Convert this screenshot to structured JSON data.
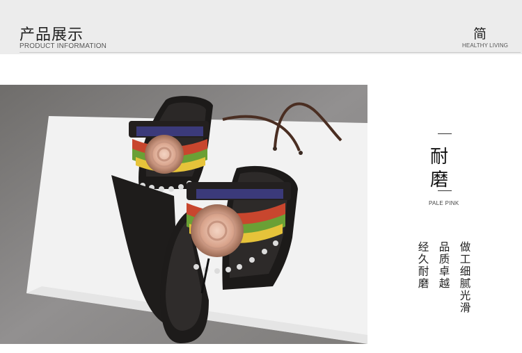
{
  "header": {
    "title": "产品展示",
    "subtitle": "PRODUCT INFORMATION",
    "brand_char": "简",
    "brand_en": "HEALTHY LIVING"
  },
  "product": {
    "feature_line1": "耐",
    "feature_line2": "磨",
    "color_name": "PALE PINK",
    "desc_col1": "做工细腻光滑",
    "desc_col2": "品质卓越",
    "desc_col3": "经久耐磨"
  },
  "colors": {
    "header_bg": "#ececec",
    "photo_bg": "#8a8886",
    "sole": "#1a1817",
    "bag": "#f1f1f1"
  }
}
